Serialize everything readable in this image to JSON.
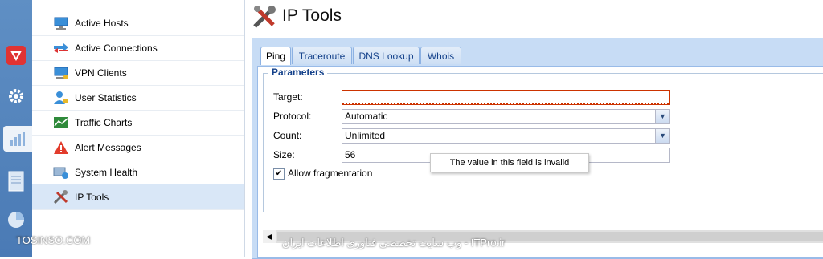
{
  "rail": {
    "icons": [
      "shield-icon",
      "gear-icon",
      "chart-icon",
      "document-icon",
      "pie-icon"
    ]
  },
  "nav": {
    "items": [
      {
        "label": "Active Hosts",
        "icon": "monitor-network-icon"
      },
      {
        "label": "Active Connections",
        "icon": "connections-icon"
      },
      {
        "label": "VPN Clients",
        "icon": "vpn-monitor-icon"
      },
      {
        "label": "User Statistics",
        "icon": "user-lock-icon"
      },
      {
        "label": "Traffic Charts",
        "icon": "traffic-chart-icon"
      },
      {
        "label": "Alert Messages",
        "icon": "alert-triangle-icon"
      },
      {
        "label": "System Health",
        "icon": "health-icon"
      },
      {
        "label": "IP Tools",
        "icon": "tools-icon",
        "selected": true
      }
    ]
  },
  "page": {
    "title": "IP Tools"
  },
  "tabs": [
    {
      "label": "Ping",
      "active": true
    },
    {
      "label": "Traceroute"
    },
    {
      "label": "DNS Lookup"
    },
    {
      "label": "Whois"
    }
  ],
  "form": {
    "legend": "Parameters",
    "target": {
      "label": "Target:",
      "value": ""
    },
    "protocol": {
      "label": "Protocol:",
      "value": "Automatic"
    },
    "count": {
      "label": "Count:",
      "value": "Unlimited"
    },
    "size": {
      "label": "Size:",
      "value": "56"
    },
    "fragment": {
      "label": "Allow fragmentation",
      "checked": true
    }
  },
  "tooltip": "The value in this field is invalid",
  "watermark": {
    "left": "TOSINSO.COM",
    "right": "وب سایت تخصصی فناوری اطلاعات ایران - ITPro.ir"
  },
  "colors": {
    "accent": "#15428b",
    "invalid": "#cc3300",
    "shield": "#e03333"
  }
}
